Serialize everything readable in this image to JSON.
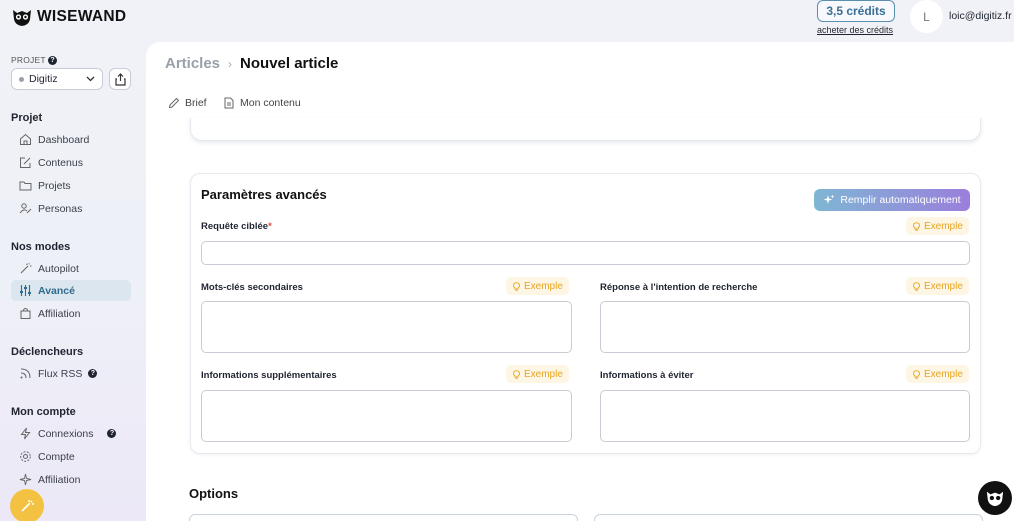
{
  "brand": {
    "name": "WISEWAND"
  },
  "header": {
    "credits": "3,5 crédits",
    "buy_link": "acheter des crédits",
    "avatar_initial": "L",
    "email": "loic@digitiz.fr"
  },
  "sidebar": {
    "project_label": "PROJET",
    "project_name": "Digitiz",
    "sections": {
      "projet": "Projet",
      "modes": "Nos modes",
      "triggers": "Déclencheurs",
      "account": "Mon compte"
    },
    "items": {
      "dashboard": "Dashboard",
      "contenus": "Contenus",
      "projets": "Projets",
      "personas": "Personas",
      "autopilot": "Autopilot",
      "avance": "Avancé",
      "affiliation": "Affiliation",
      "flux_rss": "Flux RSS",
      "connexions": "Connexions",
      "compte": "Compte",
      "affiliation2": "Affiliation"
    }
  },
  "breadcrumb": {
    "parent": "Articles",
    "current": "Nouvel article"
  },
  "tabs": {
    "brief": "Brief",
    "content": "Mon contenu"
  },
  "advanced": {
    "title": "Paramètres avancés",
    "autofill": "Remplir automatiquement",
    "example": "Exemple",
    "fields": {
      "target_query": "Requête ciblée",
      "secondary_keywords": "Mots-clés secondaires",
      "search_intent": "Réponse à l'intention de recherche",
      "extra_info": "Informations supplémentaires",
      "avoid_info": "Informations à éviter"
    }
  },
  "options": {
    "title": "Options"
  },
  "colors": {
    "accent": "#2f6b8f",
    "example": "#e7a521",
    "fab_left": "#f4c242"
  }
}
